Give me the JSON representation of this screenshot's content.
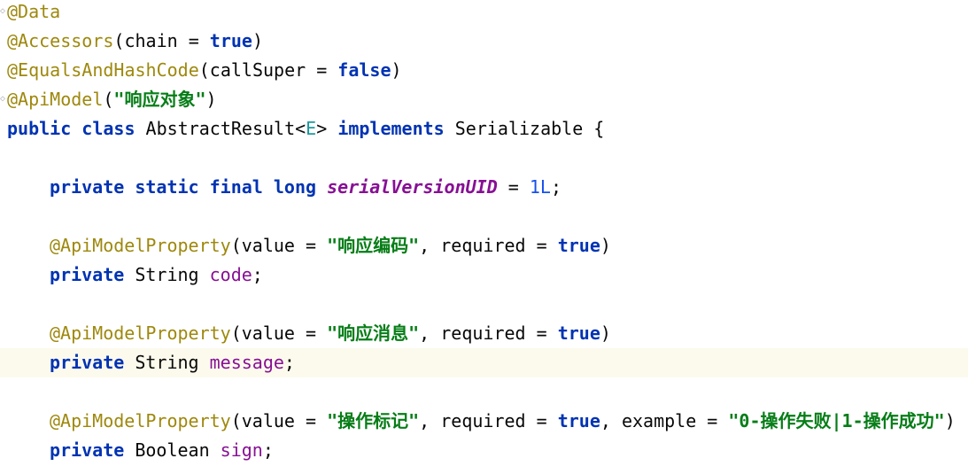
{
  "lines": [
    {
      "tokens": [
        {
          "t": "@Data",
          "c": "ann"
        }
      ],
      "indent": false,
      "fold": true
    },
    {
      "tokens": [
        {
          "t": "@Accessors",
          "c": "ann"
        },
        {
          "t": "(chain = ",
          "c": ""
        },
        {
          "t": "true",
          "c": "kw"
        },
        {
          "t": ")",
          "c": ""
        }
      ],
      "indent": false,
      "fold": false
    },
    {
      "tokens": [
        {
          "t": "@EqualsAndHashCode",
          "c": "ann"
        },
        {
          "t": "(callSuper = ",
          "c": ""
        },
        {
          "t": "false",
          "c": "kw"
        },
        {
          "t": ")",
          "c": ""
        }
      ],
      "indent": false,
      "fold": false
    },
    {
      "tokens": [
        {
          "t": "@ApiModel",
          "c": "ann"
        },
        {
          "t": "(",
          "c": ""
        },
        {
          "t": "\"响应对象\"",
          "c": "str"
        },
        {
          "t": ")",
          "c": ""
        }
      ],
      "indent": false,
      "fold": true
    },
    {
      "tokens": [
        {
          "t": "public class ",
          "c": "kw"
        },
        {
          "t": "AbstractResult<",
          "c": ""
        },
        {
          "t": "E",
          "c": "tp"
        },
        {
          "t": "> ",
          "c": ""
        },
        {
          "t": "implements ",
          "c": "kw"
        },
        {
          "t": "Serializable {",
          "c": ""
        }
      ],
      "indent": false,
      "fold": false
    },
    {
      "tokens": [],
      "indent": false,
      "fold": false
    },
    {
      "tokens": [
        {
          "t": "private static final long ",
          "c": "kw"
        },
        {
          "t": "serialVersionUID",
          "c": "static-field"
        },
        {
          "t": " = ",
          "c": ""
        },
        {
          "t": "1L",
          "c": "num"
        },
        {
          "t": ";",
          "c": ""
        }
      ],
      "indent": true,
      "fold": false
    },
    {
      "tokens": [],
      "indent": false,
      "fold": false
    },
    {
      "tokens": [
        {
          "t": "@ApiModelProperty",
          "c": "ann"
        },
        {
          "t": "(value = ",
          "c": ""
        },
        {
          "t": "\"响应编码\"",
          "c": "str"
        },
        {
          "t": ", required = ",
          "c": ""
        },
        {
          "t": "true",
          "c": "kw"
        },
        {
          "t": ")",
          "c": ""
        }
      ],
      "indent": true,
      "fold": false
    },
    {
      "tokens": [
        {
          "t": "private ",
          "c": "kw"
        },
        {
          "t": "String ",
          "c": ""
        },
        {
          "t": "code",
          "c": "field"
        },
        {
          "t": ";",
          "c": ""
        }
      ],
      "indent": true,
      "fold": false
    },
    {
      "tokens": [],
      "indent": false,
      "fold": false
    },
    {
      "tokens": [
        {
          "t": "@ApiModelProperty",
          "c": "ann"
        },
        {
          "t": "(value = ",
          "c": ""
        },
        {
          "t": "\"响应消息\"",
          "c": "str"
        },
        {
          "t": ", required = ",
          "c": ""
        },
        {
          "t": "true",
          "c": "kw"
        },
        {
          "t": ")",
          "c": ""
        }
      ],
      "indent": true,
      "fold": false
    },
    {
      "tokens": [
        {
          "t": "private ",
          "c": "kw"
        },
        {
          "t": "String ",
          "c": ""
        },
        {
          "t": "message",
          "c": "field"
        },
        {
          "t": ";",
          "c": ""
        }
      ],
      "indent": true,
      "fold": false,
      "current": true
    },
    {
      "tokens": [],
      "indent": false,
      "fold": false
    },
    {
      "tokens": [
        {
          "t": "@ApiModelProperty",
          "c": "ann"
        },
        {
          "t": "(value = ",
          "c": ""
        },
        {
          "t": "\"操作标记\"",
          "c": "str"
        },
        {
          "t": ", required = ",
          "c": ""
        },
        {
          "t": "true",
          "c": "kw"
        },
        {
          "t": ", example = ",
          "c": ""
        },
        {
          "t": "\"0-操作失败|1-操作成功\"",
          "c": "str"
        },
        {
          "t": ")",
          "c": ""
        }
      ],
      "indent": true,
      "fold": false
    },
    {
      "tokens": [
        {
          "t": "private ",
          "c": "kw"
        },
        {
          "t": "Boolean ",
          "c": ""
        },
        {
          "t": "sign",
          "c": "field"
        },
        {
          "t": ";",
          "c": ""
        }
      ],
      "indent": true,
      "fold": false
    }
  ],
  "colors": {
    "annotation": "#9e880d",
    "keyword": "#0033b3",
    "string": "#067d17",
    "number": "#1750eb",
    "type_param": "#20999d",
    "field": "#871094",
    "current_line": "#fcfaed"
  }
}
